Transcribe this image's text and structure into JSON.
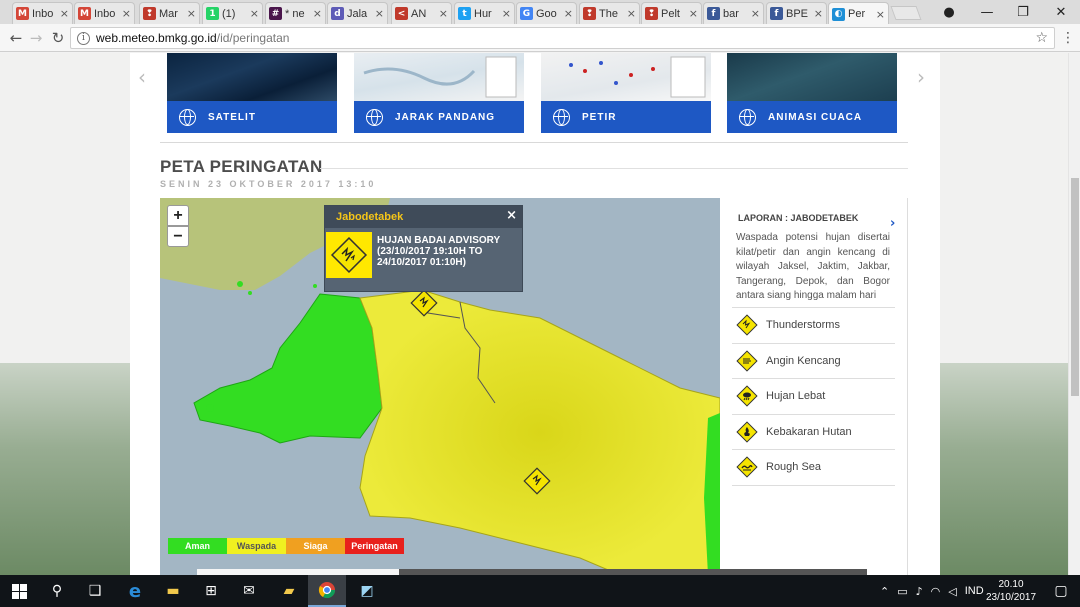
{
  "browser": {
    "tabs": [
      {
        "label": "Inbo",
        "icon": "gmail-icon",
        "color": "#d44638",
        "glyph": "M"
      },
      {
        "label": "Inbo",
        "icon": "gmail-icon",
        "color": "#d44638",
        "glyph": "M"
      },
      {
        "label": "Mar",
        "icon": "pin-icon",
        "color": "#c0392b",
        "glyph": "❢"
      },
      {
        "label": "(1)",
        "icon": "whatsapp-icon",
        "color": "#25d366",
        "glyph": "1"
      },
      {
        "label": "* ne",
        "icon": "slack-icon",
        "color": "#4a154b",
        "glyph": "#"
      },
      {
        "label": "Jala",
        "icon": "site-icon",
        "color": "#5e5bb7",
        "glyph": "d"
      },
      {
        "label": "AN",
        "icon": "share-icon",
        "color": "#c0392b",
        "glyph": "<"
      },
      {
        "label": "Hur",
        "icon": "twitter-icon",
        "color": "#1da1f2",
        "glyph": "t"
      },
      {
        "label": "Goo",
        "icon": "google-icon",
        "color": "#4285f4",
        "glyph": "G"
      },
      {
        "label": "The",
        "icon": "pin-icon",
        "color": "#c0392b",
        "glyph": "❢"
      },
      {
        "label": "Pelt",
        "icon": "pin-icon",
        "color": "#c0392b",
        "glyph": "❢"
      },
      {
        "label": "bar",
        "icon": "facebook-icon",
        "color": "#3b5998",
        "glyph": "f"
      },
      {
        "label": "BPE",
        "icon": "facebook-icon",
        "color": "#3b5998",
        "glyph": "f"
      },
      {
        "label": "Per",
        "icon": "bmkg-icon",
        "color": "#1e8fd6",
        "glyph": "◐",
        "active": true
      }
    ],
    "url_host": "web.meteo.bmkg.go.id",
    "url_path": "/id/peringatan"
  },
  "carousel": {
    "cards": [
      {
        "label": "SATELIT"
      },
      {
        "label": "JARAK PANDANG"
      },
      {
        "label": "PETIR"
      },
      {
        "label": "ANIMASI CUACA"
      }
    ]
  },
  "section": {
    "title": "PETA PERINGATAN",
    "date": "SENIN 23 OKTOBER 2017 13:10"
  },
  "map": {
    "zoom_in": "+",
    "zoom_out": "−",
    "popup": {
      "title": "Jabodetabek",
      "close": "×",
      "text": "HUJAN BADAI ADVISORY (23/10/2017 19:10H TO 24/10/2017 01:10H)"
    },
    "legend": [
      {
        "label": "Aman",
        "color": "#33dd22"
      },
      {
        "label": "Waspada",
        "color": "#f0f020"
      },
      {
        "label": "Siaga",
        "color": "#f0a020"
      },
      {
        "label": "Peringatan",
        "color": "#e8201c"
      }
    ]
  },
  "panel": {
    "heading": "LAPORAN : JABODETABEK",
    "description": "Waspada potensi hujan disertai kilat/petir dan angin kencang di wilayah Jaksel, Jaktim, Jakbar, Tangerang, Depok, dan Bogor antara siang hingga malam hari",
    "items": [
      {
        "label": "Thunderstorms",
        "icon": "thunderstorm-icon"
      },
      {
        "label": "Angin Kencang",
        "icon": "wind-icon"
      },
      {
        "label": "Hujan Lebat",
        "icon": "heavy-rain-icon"
      },
      {
        "label": "Kebakaran Hutan",
        "icon": "forest-fire-icon"
      },
      {
        "label": "Rough Sea",
        "icon": "rough-sea-icon"
      }
    ]
  },
  "taskbar": {
    "language": "IND",
    "time": "20.10",
    "date": "23/10/2017"
  }
}
